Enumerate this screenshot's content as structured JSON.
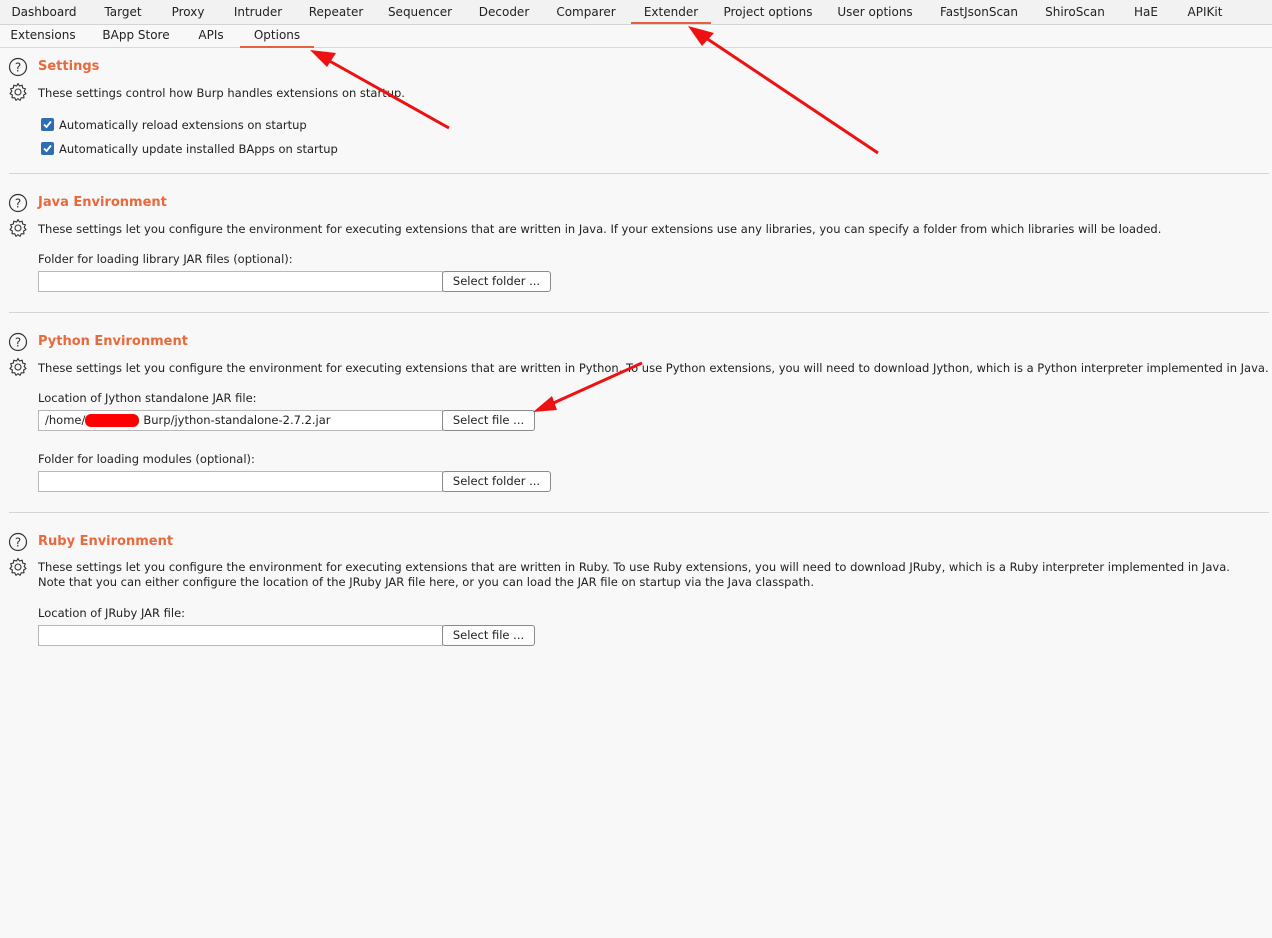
{
  "main_tabs": [
    "Dashboard",
    "Target",
    "Proxy",
    "Intruder",
    "Repeater",
    "Sequencer",
    "Decoder",
    "Comparer",
    "Extender",
    "Project options",
    "User options",
    "FastJsonScan",
    "ShiroScan",
    "HaE",
    "APIKit"
  ],
  "main_tabs_active": "Extender",
  "sub_tabs": [
    "Extensions",
    "BApp Store",
    "APIs",
    "Options"
  ],
  "sub_tabs_active": "Options",
  "accent_color": "#e8693b",
  "annotation_color": "#ee1111",
  "settings": {
    "title": "Settings",
    "description": "These settings control how Burp handles extensions on startup.",
    "options": [
      {
        "label": "Automatically reload extensions on startup",
        "checked": true
      },
      {
        "label": "Automatically update installed BApps on startup",
        "checked": true
      }
    ]
  },
  "java": {
    "title": "Java Environment",
    "description": "These settings let you configure the environment for executing extensions that are written in Java. If your extensions use any libraries, you can specify a folder from which libraries will be loaded.",
    "folder_label": "Folder for loading library JAR files (optional):",
    "folder_value": "",
    "folder_button": "Select folder ..."
  },
  "python": {
    "title": "Python Environment",
    "description": "These settings let you configure the environment for executing extensions that are written in Python. To use Python extensions, you will need to download Jython, which is a Python interpreter implemented in Java.",
    "jar_label": "Location of Jython standalone JAR file:",
    "jar_value_prefix": "/home/",
    "jar_value_suffix": "Burp/jython-standalone-2.7.2.jar",
    "jar_button": "Select file ...",
    "modules_label": "Folder for loading modules (optional):",
    "modules_value": "",
    "modules_button": "Select folder ..."
  },
  "ruby": {
    "title": "Ruby Environment",
    "description": "These settings let you configure the environment for executing extensions that are written in Ruby. To use Ruby extensions, you will need to download JRuby, which is a Ruby interpreter implemented in Java. Note that you can either configure the location of the JRuby JAR file here, or you can load the JAR file on startup via the Java classpath.",
    "jar_label": "Location of JRuby JAR file:",
    "jar_value": "",
    "jar_button": "Select file ..."
  }
}
